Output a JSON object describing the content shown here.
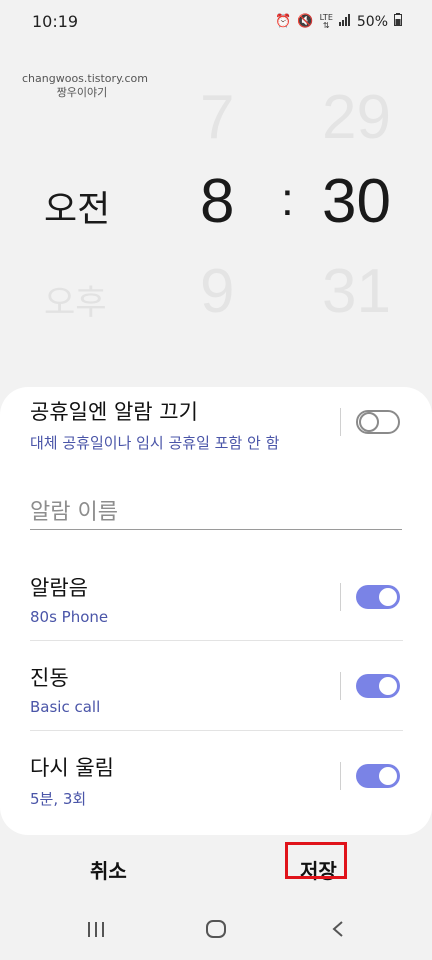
{
  "status_bar": {
    "time": "10:19",
    "icons": [
      "alarm-icon",
      "mute-icon",
      "lte-icon",
      "signal-icon",
      "battery-icon"
    ],
    "lte_label": "LTE",
    "battery_percent": "50%"
  },
  "watermark": {
    "line1": "changwoos.tistory.com",
    "line2": "짱우이야기"
  },
  "time_picker": {
    "ampm_current": "오전",
    "ampm_next": "오후",
    "hour_prev": "7",
    "hour_current": "8",
    "hour_next": "9",
    "separator": ":",
    "minute_prev": "29",
    "minute_current": "30",
    "minute_next": "31"
  },
  "settings": {
    "holiday_off": {
      "title": "공휴일엔 알람 끄기",
      "subtitle": "대체 공휴일이나 임시 공휴일 포함 안 함",
      "enabled": false
    },
    "alarm_name_placeholder": "알람 이름",
    "alarm_sound": {
      "title": "알람음",
      "subtitle": "80s Phone",
      "enabled": true
    },
    "vibration": {
      "title": "진동",
      "subtitle": "Basic call",
      "enabled": true
    },
    "snooze": {
      "title": "다시 울림",
      "subtitle": "5분, 3회",
      "enabled": true
    }
  },
  "actions": {
    "cancel_label": "취소",
    "save_label": "저장"
  },
  "navbar": {
    "recents_icon": "recents-icon",
    "home_icon": "home-icon",
    "back_icon": "back-icon"
  },
  "colors": {
    "accent": "#7a83e6",
    "subtitle": "#4a55a8",
    "highlight_box": "#e0131a"
  }
}
